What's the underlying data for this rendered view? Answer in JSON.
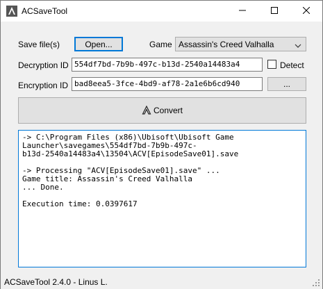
{
  "window": {
    "title": "ACSaveTool"
  },
  "form": {
    "save_files_label": "Save file(s)",
    "open_button": "Open...",
    "game_label": "Game",
    "game_selected": "Assassin's Creed Valhalla",
    "decryption_label": "Decryption ID",
    "decryption_value": "554df7bd-7b9b-497c-b13d-2540a14483a4",
    "detect_label": "Detect",
    "detect_checked": false,
    "encryption_label": "Encryption ID",
    "encryption_value": "bad8eea5-3fce-4bd9-af78-2a1e6b6cd940",
    "browse_button": "...",
    "convert_button": "Convert"
  },
  "output": {
    "text": "-> C:\\Program Files (x86)\\Ubisoft\\Ubisoft Game\nLauncher\\savegames\\554df7bd-7b9b-497c-\nb13d-2540a14483a4\\13504\\ACV[EpisodeSave01].save\n\n-> Processing \"ACV[EpisodeSave01].save\" ...\nGame title: Assassin's Creed Valhalla\n... Done.\n\nExecution time: 0.0397617"
  },
  "status": {
    "text": "ACSaveTool 2.4.0 - Linus L."
  },
  "icons": {
    "app": "assassins-creed-logo-icon",
    "minimize": "minimize-icon",
    "maximize": "maximize-icon",
    "close": "close-icon",
    "dropdown": "chevron-down-icon",
    "convert": "assassins-creed-logo-icon",
    "grip": "resize-grip-icon"
  },
  "colors": {
    "focus": "#0078d7",
    "button_bg": "#e1e1e1",
    "window_bg": "#f0f0f0"
  }
}
